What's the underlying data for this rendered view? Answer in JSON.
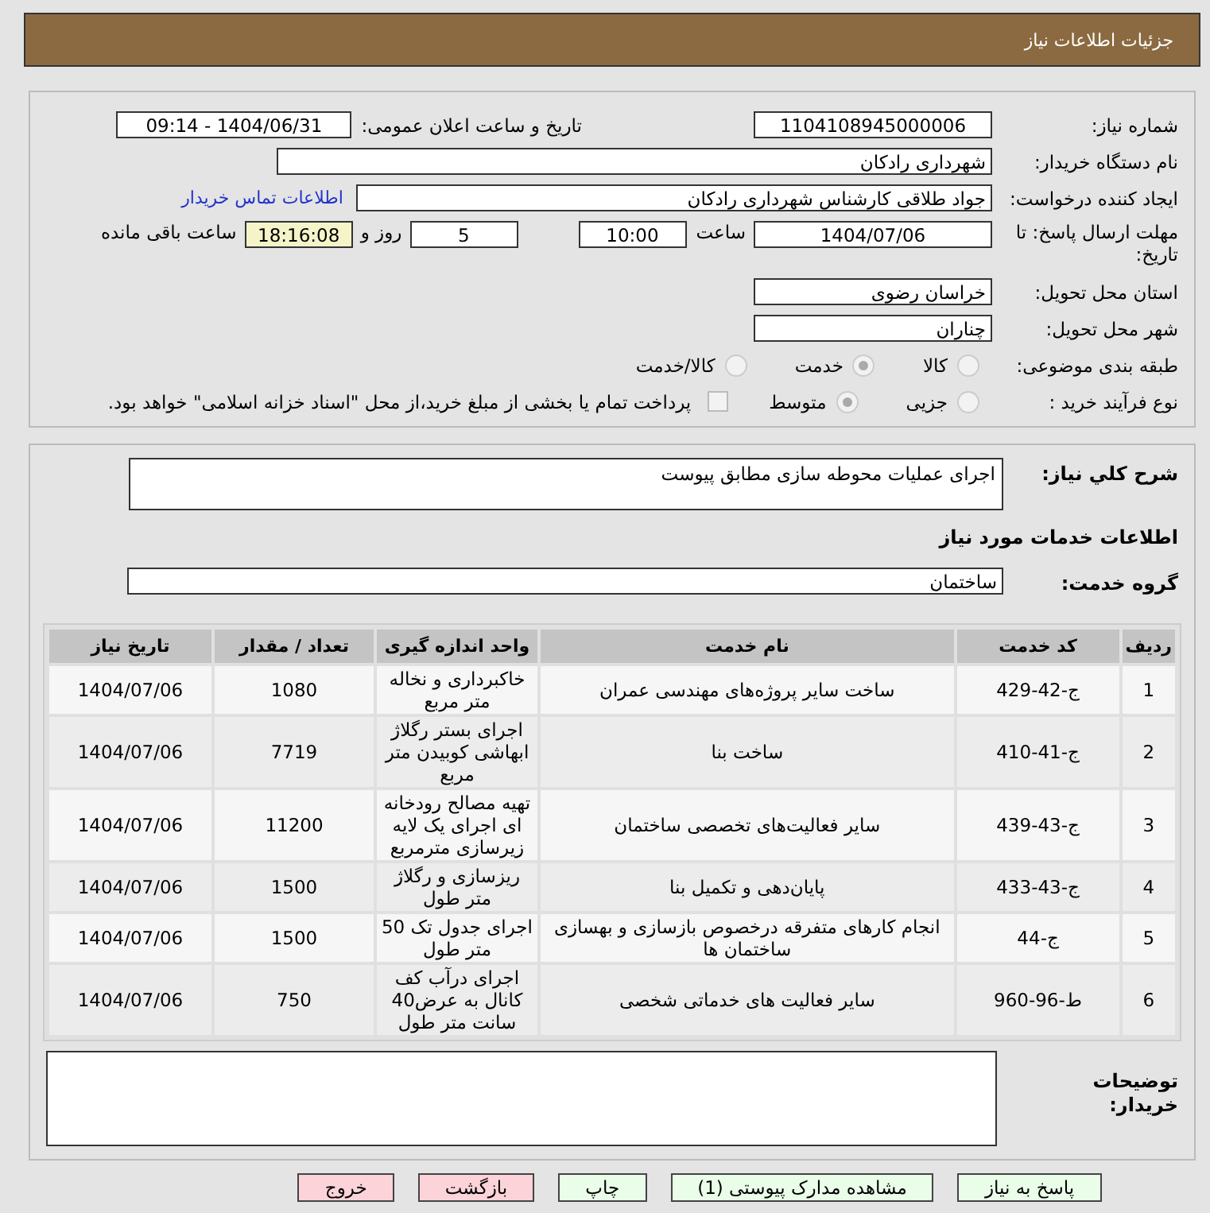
{
  "header": {
    "title": "جزئیات اطلاعات نیاز"
  },
  "need_number": {
    "label": "شماره نیاز:",
    "value": "1104108945000006"
  },
  "announce": {
    "label": "تاریخ و ساعت اعلان عمومی:",
    "value": "1404/06/31 - 09:14"
  },
  "buyer_org": {
    "label": "نام دستگاه خریدار:",
    "value": "شهرداری رادکان"
  },
  "requester": {
    "label": "ایجاد کننده درخواست:",
    "value": "جواد طلاقی کارشناس شهرداری رادکان",
    "link": "اطلاعات تماس خریدار"
  },
  "deadline": {
    "label": "مهلت ارسال پاسخ: تا تاریخ:",
    "date": "1404/07/06",
    "time_label": "ساعت",
    "time": "10:00",
    "days": "5",
    "days_label": "روز و",
    "remaining": "18:16:08",
    "remaining_label": "ساعت باقی مانده"
  },
  "province": {
    "label": "استان محل تحویل:",
    "value": "خراسان رضوی"
  },
  "city": {
    "label": "شهر محل تحویل:",
    "value": "چناران"
  },
  "category": {
    "label": "طبقه بندی موضوعی:",
    "options": [
      {
        "label": "کالا",
        "selected": false
      },
      {
        "label": "خدمت",
        "selected": true
      },
      {
        "label": "کالا/خدمت",
        "selected": false
      }
    ]
  },
  "process": {
    "label": "نوع فرآیند خرید :",
    "options": [
      {
        "label": "جزیی",
        "selected": false
      },
      {
        "label": "متوسط",
        "selected": true
      }
    ],
    "payment": {
      "checked": false,
      "text": "پرداخت تمام یا بخشی از مبلغ خرید،از محل \"اسناد خزانه اسلامی\" خواهد بود."
    }
  },
  "description": {
    "label": "شرح کلي نياز:",
    "value": "اجرای عملیات محوطه سازی مطابق پیوست"
  },
  "services_heading": "اطلاعات خدمات مورد نياز",
  "service_group": {
    "label": "گروه خدمت:",
    "value": "ساختمان"
  },
  "table": {
    "columns": [
      "ردیف",
      "کد خدمت",
      "نام خدمت",
      "واحد اندازه گیری",
      "تعداد / مقدار",
      "تاریخ نیاز"
    ],
    "rows": [
      [
        "1",
        "ج-42-429",
        "ساخت سایر پروژه‌های مهندسی عمران",
        "خاکبرداری و نخاله متر مربع",
        "1080",
        "1404/07/06"
      ],
      [
        "2",
        "ج-41-410",
        "ساخت بنا",
        "اجرای بستر رگلاژ ابهاشی کوبیدن متر مربع",
        "7719",
        "1404/07/06"
      ],
      [
        "3",
        "ج-43-439",
        "سایر فعالیت‌های تخصصی ساختمان",
        "تهیه مصالح رودخانه ای اجرای یک لایه زیرسازی مترمربع",
        "11200",
        "1404/07/06"
      ],
      [
        "4",
        "ج-43-433",
        "پایان‌دهی و تکمیل بنا",
        "ریزسازی و رگلاژ متر طول",
        "1500",
        "1404/07/06"
      ],
      [
        "5",
        "ج-44",
        "انجام کارهای متفرقه درخصوص بازسازی و بهسازی ساختمان ها",
        "اجرای جدول تک 50 متر طول",
        "1500",
        "1404/07/06"
      ],
      [
        "6",
        "ط-96-960",
        "سایر فعالیت های خدماتی شخصی",
        "اجرای درآب کف کانال به عرض40 سانت متر طول",
        "750",
        "1404/07/06"
      ]
    ]
  },
  "buyer_notes": {
    "label": "توضیحات خریدار:"
  },
  "buttons": [
    {
      "label": "پاسخ به نیاز",
      "kind": "confirm"
    },
    {
      "label": "مشاهده مدارک پیوستی (1)",
      "kind": "confirm"
    },
    {
      "label": "چاپ",
      "kind": "confirm"
    },
    {
      "label": "بازگشت",
      "kind": "cancel"
    },
    {
      "label": "خروج",
      "kind": "cancel"
    }
  ]
}
